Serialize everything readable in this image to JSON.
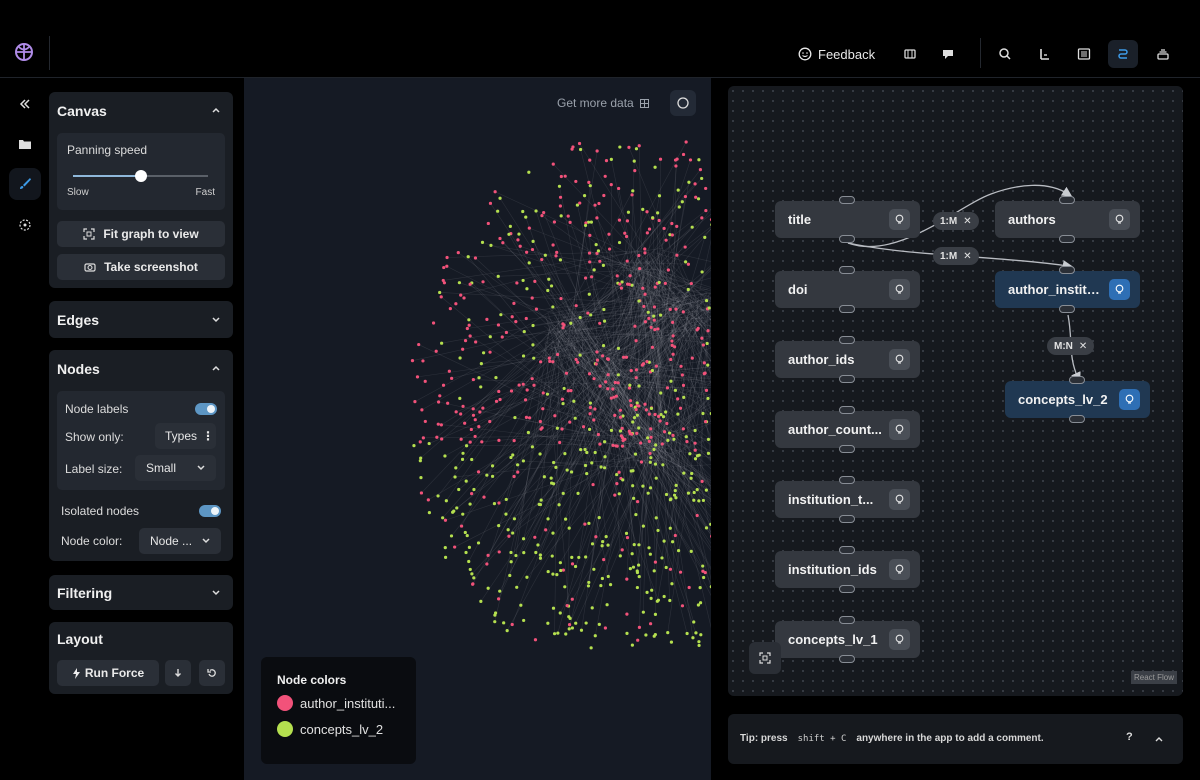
{
  "topbar": {
    "feedback_label": "Feedback",
    "icons": [
      "map-icon",
      "ticket-icon",
      "search-icon",
      "sort-icon",
      "table-icon",
      "schema-icon",
      "stack-icon"
    ]
  },
  "rail": {
    "items": [
      "collapse-icon",
      "folder-icon",
      "brush-icon",
      "select-icon"
    ]
  },
  "canvas_panel": {
    "title": "Canvas",
    "panning_label": "Panning speed",
    "panning_value": 0.5,
    "slow_label": "Slow",
    "fast_label": "Fast",
    "fit_label": "Fit graph to view",
    "screenshot_label": "Take screenshot"
  },
  "edges_panel": {
    "title": "Edges"
  },
  "nodes_panel": {
    "title": "Nodes",
    "node_labels": "Node labels",
    "node_labels_on": true,
    "show_only": "Show only:",
    "show_only_value": "Types",
    "label_size": "Label size:",
    "label_size_value": "Small",
    "isolated": "Isolated nodes",
    "isolated_on": true,
    "node_color": "Node color:",
    "node_color_value": "Node ..."
  },
  "filtering_panel": {
    "title": "Filtering"
  },
  "layout_panel": {
    "title": "Layout",
    "run_force": "Run Force"
  },
  "graph": {
    "get_more": "Get more data",
    "legend_title": "Node colors",
    "legend": [
      {
        "label": "author_instituti...",
        "color": "#f2527a"
      },
      {
        "label": "concepts_lv_2",
        "color": "#b5e04f"
      }
    ]
  },
  "schema": {
    "nodes": [
      {
        "label": "title",
        "highlight": false
      },
      {
        "label": "doi",
        "highlight": false
      },
      {
        "label": "author_ids",
        "highlight": false
      },
      {
        "label": "author_count...",
        "highlight": false
      },
      {
        "label": "institution_t...",
        "highlight": false
      },
      {
        "label": "institution_ids",
        "highlight": false
      },
      {
        "label": "concepts_lv_1",
        "highlight": false
      },
      {
        "label": "authors",
        "highlight": false
      },
      {
        "label": "author_institu...",
        "highlight": true
      },
      {
        "label": "concepts_lv_2",
        "highlight": true
      }
    ],
    "edges": [
      "1:M",
      "1:M",
      "M:N"
    ],
    "attribution": "React Flow"
  },
  "tipbar": {
    "prefix": "Tip: press",
    "keys": "shift + C",
    "suffix": "anywhere in the app to add a comment.",
    "help": "?"
  }
}
